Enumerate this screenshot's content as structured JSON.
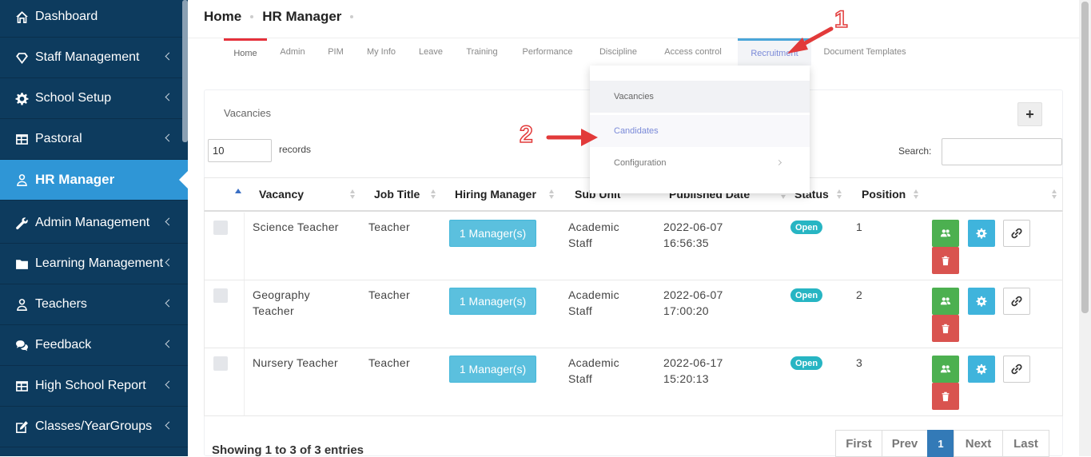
{
  "sidebar": {
    "items": [
      {
        "label": "Dashboard",
        "icon": "home-icon",
        "chevron": false
      },
      {
        "label": "Staff Management",
        "icon": "diamond-icon",
        "chevron": true
      },
      {
        "label": "School Setup",
        "icon": "gear-icon",
        "chevron": true
      },
      {
        "label": "Pastoral",
        "icon": "table-icon",
        "chevron": true
      },
      {
        "label": "HR Manager",
        "icon": "user-icon",
        "chevron": false,
        "active": true
      },
      {
        "label": "Admin Management",
        "icon": "wrench-icon",
        "chevron": true
      },
      {
        "label": "Learning Management",
        "icon": "folder-icon",
        "chevron": true
      },
      {
        "label": "Teachers",
        "icon": "user-icon",
        "chevron": true
      },
      {
        "label": "Feedback",
        "icon": "comments-icon",
        "chevron": true
      },
      {
        "label": "High School Report",
        "icon": "table-icon",
        "chevron": true
      },
      {
        "label": "Classes/YearGroups",
        "icon": "edit-icon",
        "chevron": true
      }
    ]
  },
  "breadcrumb": {
    "home": "Home",
    "current": "HR Manager"
  },
  "tabs": [
    "Home",
    "Admin",
    "PIM",
    "My Info",
    "Leave",
    "Training",
    "Performance",
    "Discipline",
    "Access control",
    "Recruitment",
    "Document Templates"
  ],
  "dropdown": {
    "items": [
      "Vacancies",
      "Candidates",
      "Configuration"
    ]
  },
  "panel": {
    "title": "Vacancies",
    "add_label": "+",
    "records_value": "10",
    "records_label": "records",
    "search_label": "Search:"
  },
  "table": {
    "headers": [
      "Vacancy",
      "Job Title",
      "Hiring Manager",
      "Sub Unit",
      "Published Date",
      "Status",
      "Position"
    ],
    "rows": [
      {
        "vacancy_l1": "Science Teacher",
        "vacancy_l2": "",
        "job_title": "Teacher",
        "manager": "1 Manager(s)",
        "sub_unit_l1": "Academic",
        "sub_unit_l2": "Staff",
        "date": "2022-06-07",
        "time": "16:56:35",
        "status": "Open",
        "position": "1"
      },
      {
        "vacancy_l1": "Geography",
        "vacancy_l2": "Teacher",
        "job_title": "Teacher",
        "manager": "1 Manager(s)",
        "sub_unit_l1": "Academic",
        "sub_unit_l2": "Staff",
        "date": "2022-06-07",
        "time": "17:00:20",
        "status": "Open",
        "position": "2"
      },
      {
        "vacancy_l1": "Nursery Teacher",
        "vacancy_l2": "",
        "job_title": "Teacher",
        "manager": "1 Manager(s)",
        "sub_unit_l1": "Academic",
        "sub_unit_l2": "Staff",
        "date": "2022-06-17",
        "time": "15:20:13",
        "status": "Open",
        "position": "3"
      }
    ]
  },
  "footer": {
    "summary": "Showing 1 to 3 of 3 entries"
  },
  "pagination": [
    "First",
    "Prev",
    "1",
    "Next",
    "Last"
  ],
  "annotations": {
    "step1": "1",
    "step2": "2"
  },
  "colors": {
    "sidebar": "#0d3b5e",
    "active": "#2f96d6",
    "annotation": "#e23a3a",
    "badge": "#27b5c3"
  }
}
